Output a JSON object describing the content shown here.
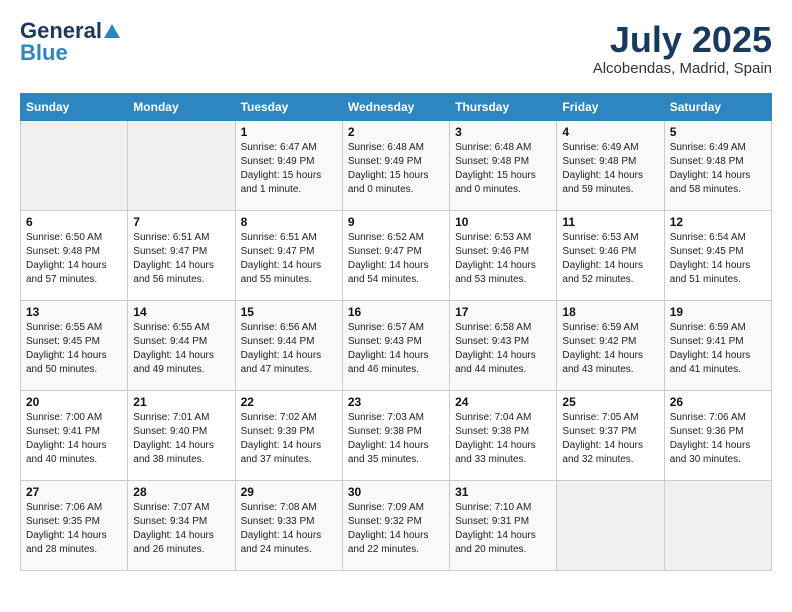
{
  "logo": {
    "part1": "General",
    "part2": "Blue"
  },
  "title": {
    "month_year": "July 2025",
    "location": "Alcobendas, Madrid, Spain"
  },
  "days_of_week": [
    "Sunday",
    "Monday",
    "Tuesday",
    "Wednesday",
    "Thursday",
    "Friday",
    "Saturday"
  ],
  "weeks": [
    [
      {
        "day": "",
        "empty": true
      },
      {
        "day": "",
        "empty": true
      },
      {
        "day": "1",
        "sunrise": "Sunrise: 6:47 AM",
        "sunset": "Sunset: 9:49 PM",
        "daylight": "Daylight: 15 hours and 1 minute."
      },
      {
        "day": "2",
        "sunrise": "Sunrise: 6:48 AM",
        "sunset": "Sunset: 9:49 PM",
        "daylight": "Daylight: 15 hours and 0 minutes."
      },
      {
        "day": "3",
        "sunrise": "Sunrise: 6:48 AM",
        "sunset": "Sunset: 9:48 PM",
        "daylight": "Daylight: 15 hours and 0 minutes."
      },
      {
        "day": "4",
        "sunrise": "Sunrise: 6:49 AM",
        "sunset": "Sunset: 9:48 PM",
        "daylight": "Daylight: 14 hours and 59 minutes."
      },
      {
        "day": "5",
        "sunrise": "Sunrise: 6:49 AM",
        "sunset": "Sunset: 9:48 PM",
        "daylight": "Daylight: 14 hours and 58 minutes."
      }
    ],
    [
      {
        "day": "6",
        "sunrise": "Sunrise: 6:50 AM",
        "sunset": "Sunset: 9:48 PM",
        "daylight": "Daylight: 14 hours and 57 minutes."
      },
      {
        "day": "7",
        "sunrise": "Sunrise: 6:51 AM",
        "sunset": "Sunset: 9:47 PM",
        "daylight": "Daylight: 14 hours and 56 minutes."
      },
      {
        "day": "8",
        "sunrise": "Sunrise: 6:51 AM",
        "sunset": "Sunset: 9:47 PM",
        "daylight": "Daylight: 14 hours and 55 minutes."
      },
      {
        "day": "9",
        "sunrise": "Sunrise: 6:52 AM",
        "sunset": "Sunset: 9:47 PM",
        "daylight": "Daylight: 14 hours and 54 minutes."
      },
      {
        "day": "10",
        "sunrise": "Sunrise: 6:53 AM",
        "sunset": "Sunset: 9:46 PM",
        "daylight": "Daylight: 14 hours and 53 minutes."
      },
      {
        "day": "11",
        "sunrise": "Sunrise: 6:53 AM",
        "sunset": "Sunset: 9:46 PM",
        "daylight": "Daylight: 14 hours and 52 minutes."
      },
      {
        "day": "12",
        "sunrise": "Sunrise: 6:54 AM",
        "sunset": "Sunset: 9:45 PM",
        "daylight": "Daylight: 14 hours and 51 minutes."
      }
    ],
    [
      {
        "day": "13",
        "sunrise": "Sunrise: 6:55 AM",
        "sunset": "Sunset: 9:45 PM",
        "daylight": "Daylight: 14 hours and 50 minutes."
      },
      {
        "day": "14",
        "sunrise": "Sunrise: 6:55 AM",
        "sunset": "Sunset: 9:44 PM",
        "daylight": "Daylight: 14 hours and 49 minutes."
      },
      {
        "day": "15",
        "sunrise": "Sunrise: 6:56 AM",
        "sunset": "Sunset: 9:44 PM",
        "daylight": "Daylight: 14 hours and 47 minutes."
      },
      {
        "day": "16",
        "sunrise": "Sunrise: 6:57 AM",
        "sunset": "Sunset: 9:43 PM",
        "daylight": "Daylight: 14 hours and 46 minutes."
      },
      {
        "day": "17",
        "sunrise": "Sunrise: 6:58 AM",
        "sunset": "Sunset: 9:43 PM",
        "daylight": "Daylight: 14 hours and 44 minutes."
      },
      {
        "day": "18",
        "sunrise": "Sunrise: 6:59 AM",
        "sunset": "Sunset: 9:42 PM",
        "daylight": "Daylight: 14 hours and 43 minutes."
      },
      {
        "day": "19",
        "sunrise": "Sunrise: 6:59 AM",
        "sunset": "Sunset: 9:41 PM",
        "daylight": "Daylight: 14 hours and 41 minutes."
      }
    ],
    [
      {
        "day": "20",
        "sunrise": "Sunrise: 7:00 AM",
        "sunset": "Sunset: 9:41 PM",
        "daylight": "Daylight: 14 hours and 40 minutes."
      },
      {
        "day": "21",
        "sunrise": "Sunrise: 7:01 AM",
        "sunset": "Sunset: 9:40 PM",
        "daylight": "Daylight: 14 hours and 38 minutes."
      },
      {
        "day": "22",
        "sunrise": "Sunrise: 7:02 AM",
        "sunset": "Sunset: 9:39 PM",
        "daylight": "Daylight: 14 hours and 37 minutes."
      },
      {
        "day": "23",
        "sunrise": "Sunrise: 7:03 AM",
        "sunset": "Sunset: 9:38 PM",
        "daylight": "Daylight: 14 hours and 35 minutes."
      },
      {
        "day": "24",
        "sunrise": "Sunrise: 7:04 AM",
        "sunset": "Sunset: 9:38 PM",
        "daylight": "Daylight: 14 hours and 33 minutes."
      },
      {
        "day": "25",
        "sunrise": "Sunrise: 7:05 AM",
        "sunset": "Sunset: 9:37 PM",
        "daylight": "Daylight: 14 hours and 32 minutes."
      },
      {
        "day": "26",
        "sunrise": "Sunrise: 7:06 AM",
        "sunset": "Sunset: 9:36 PM",
        "daylight": "Daylight: 14 hours and 30 minutes."
      }
    ],
    [
      {
        "day": "27",
        "sunrise": "Sunrise: 7:06 AM",
        "sunset": "Sunset: 9:35 PM",
        "daylight": "Daylight: 14 hours and 28 minutes."
      },
      {
        "day": "28",
        "sunrise": "Sunrise: 7:07 AM",
        "sunset": "Sunset: 9:34 PM",
        "daylight": "Daylight: 14 hours and 26 minutes."
      },
      {
        "day": "29",
        "sunrise": "Sunrise: 7:08 AM",
        "sunset": "Sunset: 9:33 PM",
        "daylight": "Daylight: 14 hours and 24 minutes."
      },
      {
        "day": "30",
        "sunrise": "Sunrise: 7:09 AM",
        "sunset": "Sunset: 9:32 PM",
        "daylight": "Daylight: 14 hours and 22 minutes."
      },
      {
        "day": "31",
        "sunrise": "Sunrise: 7:10 AM",
        "sunset": "Sunset: 9:31 PM",
        "daylight": "Daylight: 14 hours and 20 minutes."
      },
      {
        "day": "",
        "empty": true
      },
      {
        "day": "",
        "empty": true
      }
    ]
  ]
}
